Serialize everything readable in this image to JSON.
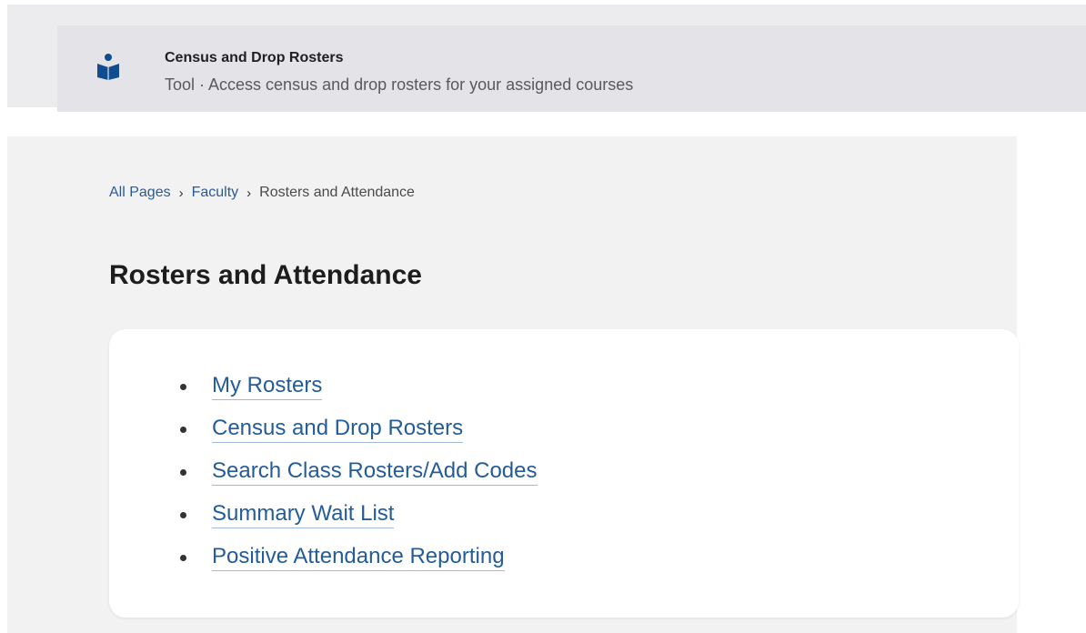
{
  "search_result": {
    "title": "Census and Drop Rosters",
    "subtitle": "Tool · Access census and drop rosters for your assigned courses",
    "icon": "reading-person-icon",
    "icon_color": "#0f4d8f"
  },
  "breadcrumb": {
    "items": [
      {
        "label": "All Pages"
      },
      {
        "label": "Faculty"
      }
    ],
    "current": "Rosters and Attendance",
    "separator": "›"
  },
  "page": {
    "title": "Rosters and Attendance"
  },
  "links": [
    {
      "label": "My Rosters"
    },
    {
      "label": "Census and Drop Rosters"
    },
    {
      "label": "Search Class Rosters/Add Codes"
    },
    {
      "label": "Summary Wait List"
    },
    {
      "label": "Positive Attendance Reporting"
    }
  ],
  "colors": {
    "link": "#245c9a",
    "breadcrumb_link": "#2a5b93",
    "panel_background": "#f2f2f3",
    "result_background": "#e3e3e8"
  }
}
